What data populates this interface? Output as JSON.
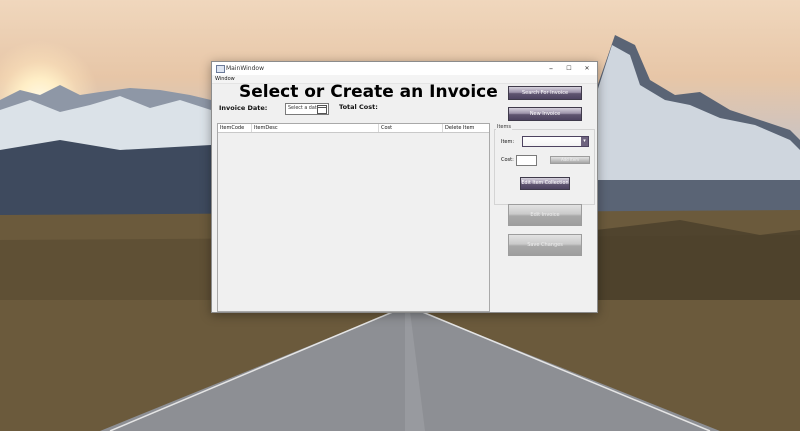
{
  "window": {
    "title": "MainWindow",
    "minimize": "–",
    "maximize": "☐",
    "close": "✕"
  },
  "menu": {
    "items": [
      {
        "label": "Window"
      }
    ]
  },
  "main": {
    "heading": "Select or Create an Invoice",
    "invoice_date_label": "Invoice Date:",
    "date_placeholder": "Select a date",
    "total_cost_label": "Total Cost:",
    "columns": [
      "ItemCode",
      "ItemDesc",
      "Cost",
      "Delete Item"
    ]
  },
  "side": {
    "search_button": "Search For Invoice",
    "new_button": "New Invoice",
    "items_group": "Items",
    "item_label": "Item:",
    "cost_label": "Cost:",
    "add_item_button": "Add Item",
    "edit_collection_button": "Edit Item Collection",
    "edit_invoice_button": "Edit Invoice",
    "save_changes_button": "Save Changes"
  },
  "colors": {
    "button_dark": "#4d4360",
    "button_disabled": "#a8a8a8",
    "window_bg": "#f0f0f0"
  }
}
